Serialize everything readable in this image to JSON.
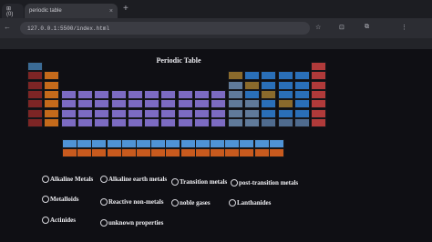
{
  "browser": {
    "tabs": [
      {
        "label": "⊞ (0)",
        "close": "×"
      },
      {
        "label": "periodic table",
        "close": "×"
      }
    ],
    "new_tab": "+",
    "url": "127.0.0.1:5500/index.html",
    "nav": {
      "back": "←",
      "forward": "→",
      "reload": "↻"
    },
    "toolbar_icons": [
      "☆",
      "⊡",
      "⧉",
      "⋮"
    ]
  },
  "page": {
    "title": "Periodic Table"
  },
  "colors": {
    "alkali": "#7d2525",
    "alkaline": "#c46a1b",
    "transition": "#7c6bc2",
    "post_transition": "#607a9a",
    "metalloid": "#8a6a2c",
    "nonmetal": "#2a6fb8",
    "noble": "#b03a3a",
    "lanthanide": "#4f93d6",
    "actinide": "#c85a1e",
    "unknown": "#4f6b8e",
    "main_block": "#3b6b95"
  },
  "legend": {
    "alkaline_metals": "Alkaline Metals",
    "alkaline_earth_metals": "Alkaline earth metals",
    "transition_metals": "Transition metals",
    "post_transition_metals": "post-transition metals",
    "metalloids": "Metalloids",
    "reactive_nonmetals": "Reactive non-metals",
    "noble_gases": "noble gases",
    "lanthanides": "Lanthanides",
    "actinides": "Actinides",
    "unknown_properties": "unknown properties"
  }
}
